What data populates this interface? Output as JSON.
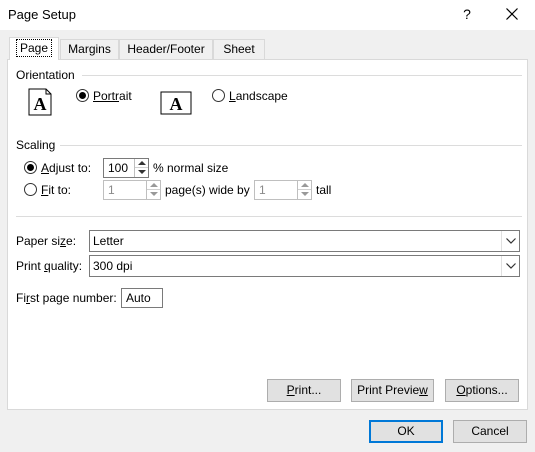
{
  "window": {
    "title": "Page Setup",
    "help_label": "?",
    "close_icon": "close-icon"
  },
  "tabs": [
    {
      "label": "Page",
      "active": true
    },
    {
      "label": "Margins",
      "active": false
    },
    {
      "label": "Header/Footer",
      "active": false
    },
    {
      "label": "Sheet",
      "active": false
    }
  ],
  "orientation": {
    "group_label": "Orientation",
    "portrait": {
      "label_u": "Portr",
      "label_rest": "ait",
      "checked": true,
      "icon": "portrait-page-icon",
      "glyph": "A"
    },
    "landscape": {
      "label_u": "L",
      "label_rest": "andscape",
      "checked": false,
      "icon": "landscape-page-icon",
      "glyph": "A"
    }
  },
  "scaling": {
    "group_label": "Scaling",
    "adjust": {
      "label_u": "A",
      "label_rest": "djust to:",
      "checked": true,
      "value": "100",
      "suffix": "% normal size"
    },
    "fit": {
      "label_u": "F",
      "label_rest": "it to:",
      "checked": false,
      "wide_value": "1",
      "wide_suffix": "page(s) wide by",
      "tall_value": "1",
      "tall_suffix": "tall"
    }
  },
  "paper_size": {
    "label_pre": "Paper si",
    "label_u": "z",
    "label_post": "e:",
    "value": "Letter"
  },
  "print_quality": {
    "label_pre": "Print ",
    "label_u": "q",
    "label_post": "uality:",
    "value": "300 dpi"
  },
  "first_page_number": {
    "label_pre": "Fi",
    "label_u": "r",
    "label_post": "st page number:",
    "value": "Auto"
  },
  "panel_buttons": {
    "print": {
      "label_u": "P",
      "label_rest": "rint..."
    },
    "print_preview": {
      "label_pre": "Print Previe",
      "label_u": "w",
      "label_post": ""
    },
    "options": {
      "label_u": "O",
      "label_rest": "ptions..."
    }
  },
  "dialog_buttons": {
    "ok": "OK",
    "cancel": "Cancel"
  },
  "colors": {
    "default_button_border": "#0078d7",
    "panel_bg": "#ffffff",
    "dialog_bg": "#f0f0f0"
  }
}
